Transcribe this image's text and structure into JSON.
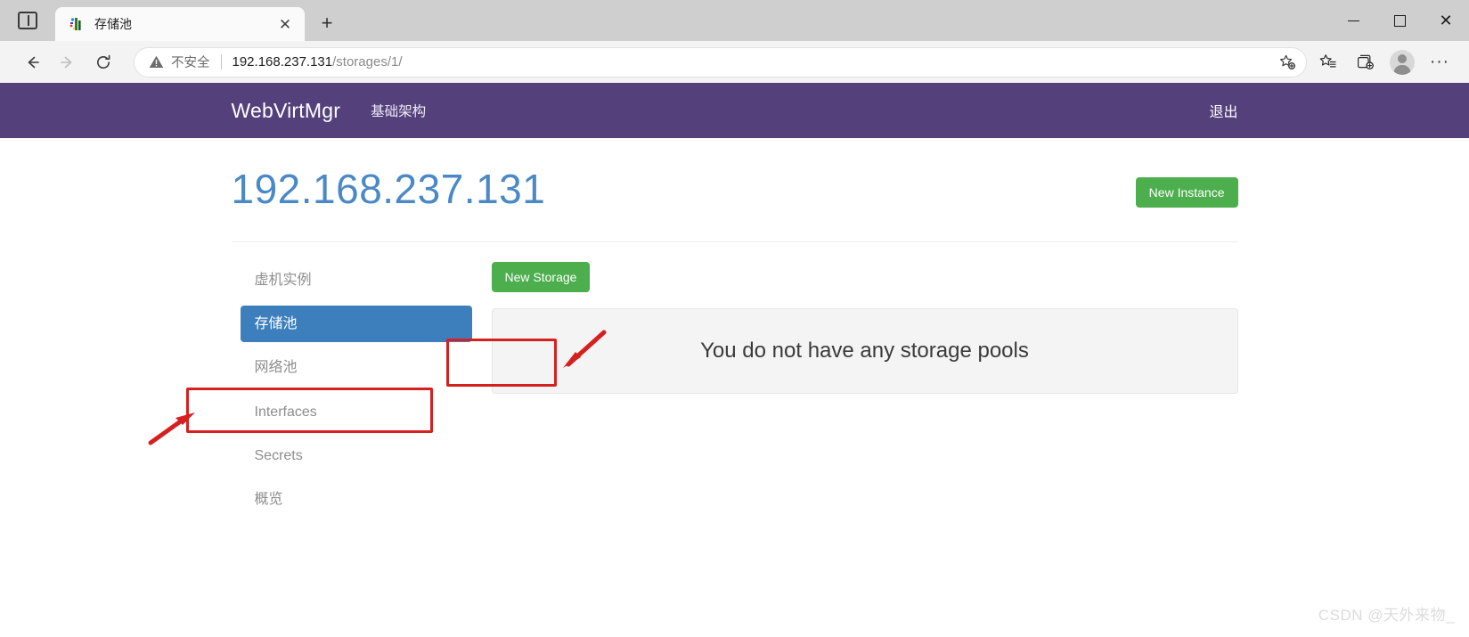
{
  "window": {
    "tab_search_icon": "tab-search-icon",
    "minimize_label": "—",
    "maximize_label": "□",
    "close_label": "✕"
  },
  "tab": {
    "title": "存储池",
    "favicon": "webvirtmgr-favicon",
    "close_label": "✕",
    "new_tab_label": "+"
  },
  "toolbar": {
    "back_label": "←",
    "forward_label": "→",
    "reload_label": "⟳",
    "security_text": "不安全",
    "security_icon": "warning-triangle-icon",
    "url_host": "192.168.237.131",
    "url_path": "/storages/1/",
    "url_full": "192.168.237.131/storages/1/",
    "add_favorite_icon": "star-plus-icon",
    "favorites_icon": "favorites-list-icon",
    "collections_icon": "collections-add-icon",
    "profile_icon": "profile-avatar-icon",
    "settings_icon": "ellipsis-icon",
    "settings_label": "···"
  },
  "navbar": {
    "brand": "WebVirtMgr",
    "links": [
      {
        "label": "基础架构"
      }
    ],
    "logout_label": "退出",
    "background": "#54417c"
  },
  "page": {
    "title": "192.168.237.131",
    "title_color": "#4a89c6",
    "new_instance_label": "New Instance",
    "new_storage_label": "New Storage",
    "button_color": "#4cae4c"
  },
  "sidebar": {
    "items": [
      {
        "label": "虚机实例",
        "active": false
      },
      {
        "label": "存储池",
        "active": true
      },
      {
        "label": "网络池",
        "active": false
      },
      {
        "label": "Interfaces",
        "active": false
      },
      {
        "label": "Secrets",
        "active": false
      },
      {
        "label": "概览",
        "active": false
      }
    ],
    "active_color": "#3d7fbc"
  },
  "main": {
    "empty_message": "You do not have any storage pools"
  },
  "annotations": {
    "highlight_color": "#d62020",
    "storage_button_box": "new-storage-highlight",
    "sidebar_box": "storage-pool-menu-highlight"
  },
  "watermark": "CSDN @天外来物_"
}
